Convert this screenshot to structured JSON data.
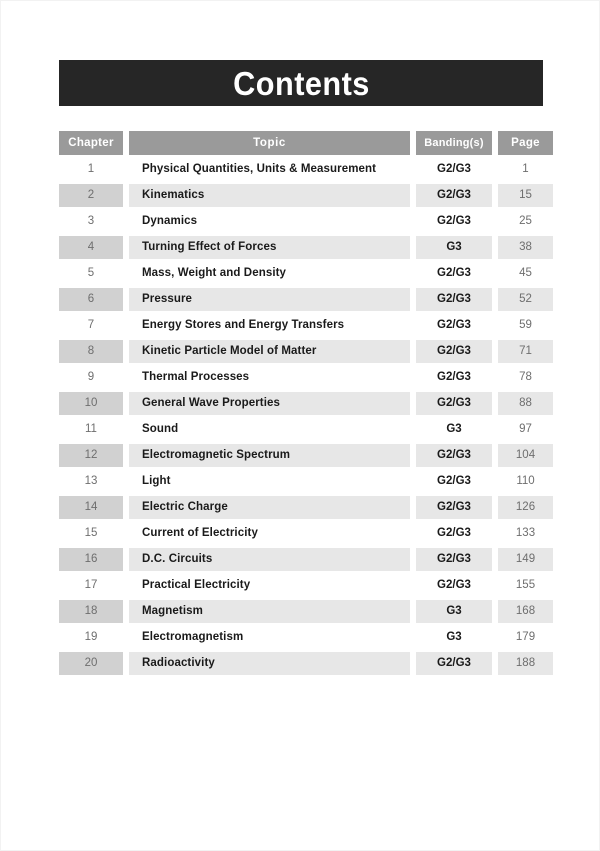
{
  "page": {
    "title_banner": "Contents"
  },
  "table": {
    "headers": {
      "chapter": "Chapter",
      "topic": "Topic",
      "banding": "Banding(s)",
      "page": "Page"
    },
    "rows": [
      {
        "chapter": "1",
        "topic": "Physical Quantities, Units & Measurement",
        "banding": "G2/G3",
        "page": "1"
      },
      {
        "chapter": "2",
        "topic": "Kinematics",
        "banding": "G2/G3",
        "page": "15"
      },
      {
        "chapter": "3",
        "topic": "Dynamics",
        "banding": "G2/G3",
        "page": "25"
      },
      {
        "chapter": "4",
        "topic": "Turning Effect of Forces",
        "banding": "G3",
        "page": "38"
      },
      {
        "chapter": "5",
        "topic": "Mass, Weight and Density",
        "banding": "G2/G3",
        "page": "45"
      },
      {
        "chapter": "6",
        "topic": "Pressure",
        "banding": "G2/G3",
        "page": "52"
      },
      {
        "chapter": "7",
        "topic": "Energy Stores and Energy Transfers",
        "banding": "G2/G3",
        "page": "59"
      },
      {
        "chapter": "8",
        "topic": "Kinetic Particle Model of Matter",
        "banding": "G2/G3",
        "page": "71"
      },
      {
        "chapter": "9",
        "topic": "Thermal Processes",
        "banding": "G2/G3",
        "page": "78"
      },
      {
        "chapter": "10",
        "topic": "General Wave Properties",
        "banding": "G2/G3",
        "page": "88"
      },
      {
        "chapter": "11",
        "topic": "Sound",
        "banding": "G3",
        "page": "97"
      },
      {
        "chapter": "12",
        "topic": "Electromagnetic Spectrum",
        "banding": "G2/G3",
        "page": "104"
      },
      {
        "chapter": "13",
        "topic": "Light",
        "banding": "G2/G3",
        "page": "110"
      },
      {
        "chapter": "14",
        "topic": "Electric Charge",
        "banding": "G2/G3",
        "page": "126"
      },
      {
        "chapter": "15",
        "topic": "Current of Electricity",
        "banding": "G2/G3",
        "page": "133"
      },
      {
        "chapter": "16",
        "topic": "D.C. Circuits",
        "banding": "G2/G3",
        "page": "149"
      },
      {
        "chapter": "17",
        "topic": "Practical Electricity",
        "banding": "G2/G3",
        "page": "155"
      },
      {
        "chapter": "18",
        "topic": "Magnetism",
        "banding": "G3",
        "page": "168"
      },
      {
        "chapter": "19",
        "topic": "Electromagnetism",
        "banding": "G3",
        "page": "179"
      },
      {
        "chapter": "20",
        "topic": "Radioactivity",
        "banding": "G2/G3",
        "page": "188"
      }
    ]
  },
  "colors": {
    "banner_background": "#262626",
    "banner_text": "#ffffff",
    "header_background": "#9a9a9a",
    "header_text": "#ffffff",
    "row_shaded_chapter": "#d1d1d1",
    "row_shaded_cell": "#e7e7e7",
    "row_plain": "#ffffff",
    "number_text": "#6e6e6e",
    "topic_text": "#1a1a1a"
  }
}
